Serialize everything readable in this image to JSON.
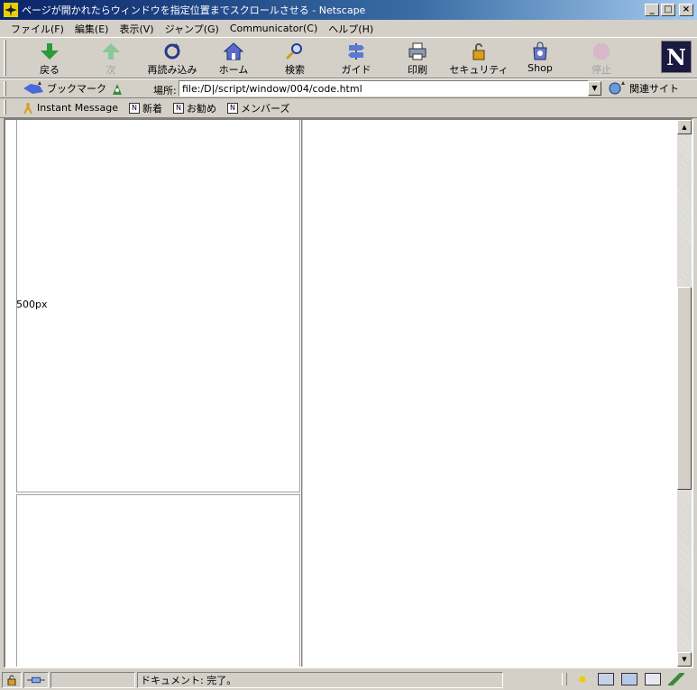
{
  "window": {
    "title": "ページが開かれたらウィンドウを指定位置までスクロールさせる - Netscape"
  },
  "menu": [
    {
      "label": "ファイル(F)"
    },
    {
      "label": "編集(E)"
    },
    {
      "label": "表示(V)"
    },
    {
      "label": "ジャンプ(G)"
    },
    {
      "label": "Communicator(C)"
    },
    {
      "label": "ヘルプ(H)"
    }
  ],
  "toolbar": {
    "back": "戻る",
    "forward": "次",
    "reload": "再読み込み",
    "home": "ホーム",
    "search": "検索",
    "guide": "ガイド",
    "print": "印刷",
    "security": "セキュリティ",
    "shop": "Shop",
    "stop": "停止"
  },
  "location": {
    "bookmarks_label": "ブックマーク",
    "label": "場所:",
    "url": "file:/D|/script/window/004/code.html",
    "related_label": "関連サイト"
  },
  "personal": [
    {
      "label": "Instant Message"
    },
    {
      "label": "新着"
    },
    {
      "label": "お勧め"
    },
    {
      "label": "メンバーズ"
    }
  ],
  "page": {
    "box_label": "500px"
  },
  "status": {
    "text": "ドキュメント: 完了。"
  }
}
